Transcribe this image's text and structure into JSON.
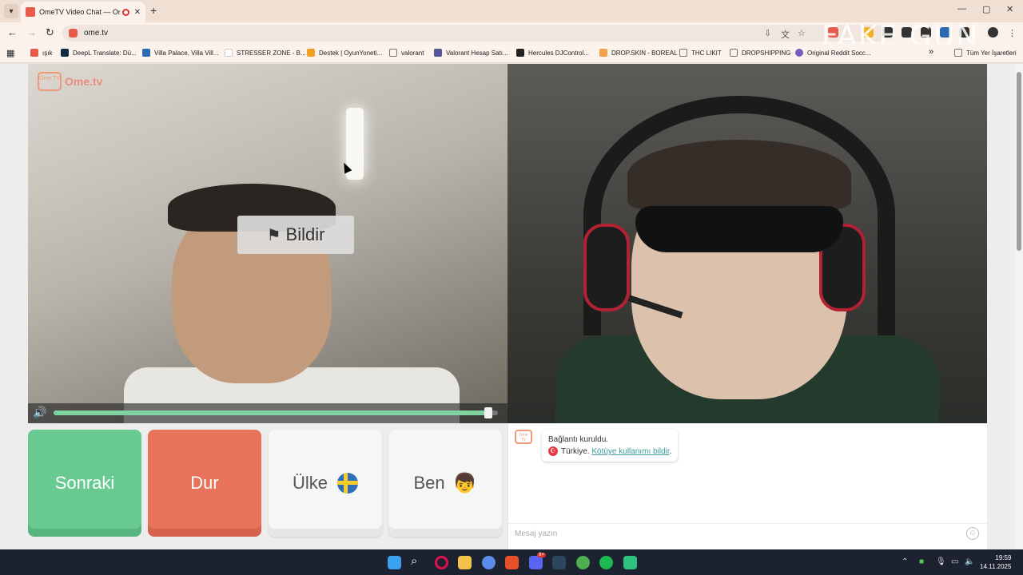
{
  "browser": {
    "tab_title": "OmeTV Video Chat — Ome",
    "close_tab": "✕",
    "new_tab": "+",
    "minimize": "—",
    "maximize": "▢",
    "close_window": "✕",
    "url": "ome.tv",
    "overlay_text": "FAKE GUN"
  },
  "bookmarks": {
    "items": [
      {
        "label": "ışık",
        "color": "#e85a4a"
      },
      {
        "label": "DeepL Translate: Dü...",
        "color": "#0f2b46"
      },
      {
        "label": "Villa Palace, Villa Vill...",
        "color": "#2d6ab4"
      },
      {
        "label": "STRESSER ZONE - B...",
        "color": "#ffffff"
      },
      {
        "label": "Destek | OyunYoneti...",
        "color": "#f0a020"
      },
      {
        "label": "valorant",
        "color": "#777777"
      },
      {
        "label": "Valorant Hesap Satı...",
        "color": "#555599"
      },
      {
        "label": "Hercules DJControl...",
        "color": "#222222"
      },
      {
        "label": "DROP.SKIN - BOREAL",
        "color": "#f4a24a"
      },
      {
        "label": "THC LIKIT",
        "color": "#777777"
      },
      {
        "label": "DROPSHIPPING",
        "color": "#777777"
      },
      {
        "label": "Original Reddit Socc...",
        "color": "#7a5cc0"
      }
    ],
    "more": "»",
    "all_bookmarks": "Tüm Yer İşaretleri"
  },
  "video": {
    "logo": "Ome.tv",
    "logo_badge": "Ome TV",
    "report_label": "Bildir",
    "volume_level": 0.98
  },
  "controls": {
    "next": "Sonraki",
    "stop": "Dur",
    "country": "Ülke",
    "me": "Ben",
    "me_emoji": "👦"
  },
  "chat": {
    "logo_badge": "Ome TV",
    "message_line1": "Bağlantı kuruldu.",
    "country_prefix": "Türkiye.",
    "report_link": "Kötüye kullanımı bildir",
    "report_suffix": ".",
    "input_placeholder": "Mesaj yazın",
    "turkey_flag_symbol": "☪"
  },
  "taskbar": {
    "time": "19:59",
    "date": "14.11.2025",
    "icons": [
      {
        "name": "start-icon",
        "color": "#3aa0f0"
      },
      {
        "name": "search-icon",
        "color": "#1c2230"
      },
      {
        "name": "opera-gx-icon",
        "color": "#e01050"
      },
      {
        "name": "file-explorer-icon",
        "color": "#f2c24b"
      },
      {
        "name": "copilot-icon",
        "color": "#5a8de8"
      },
      {
        "name": "brawl-icon",
        "color": "#e8502a"
      },
      {
        "name": "discord-icon",
        "color": "#5865f2"
      },
      {
        "name": "steam-icon",
        "color": "#1b2838"
      },
      {
        "name": "chrome-icon",
        "color": "#4caf50"
      },
      {
        "name": "spotify-icon",
        "color": "#1db954"
      },
      {
        "name": "game-icon",
        "color": "#2ec27e"
      }
    ],
    "discord_badge": "9+"
  }
}
